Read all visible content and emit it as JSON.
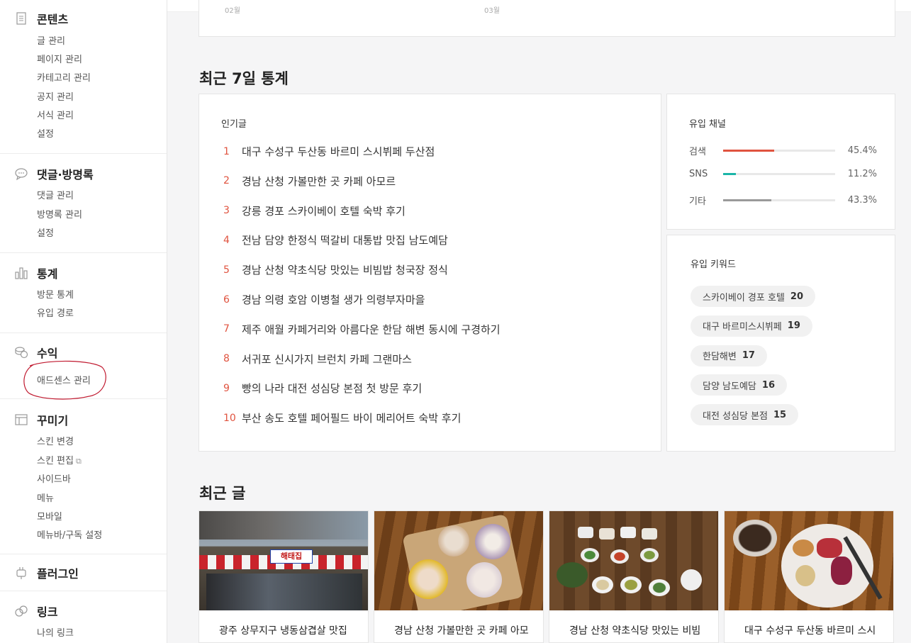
{
  "sidebar": {
    "sections": [
      {
        "icon": "document-icon",
        "title": "콘텐츠",
        "items": [
          "글 관리",
          "페이지 관리",
          "카테고리 관리",
          "공지 관리",
          "서식 관리",
          "설정"
        ]
      },
      {
        "icon": "speech-bubble-icon",
        "title": "댓글·방명록",
        "items": [
          "댓글 관리",
          "방명록 관리",
          "설정"
        ]
      },
      {
        "icon": "bar-chart-icon",
        "title": "통계",
        "items": [
          "방문 통계",
          "유입 경로"
        ]
      },
      {
        "icon": "coins-icon",
        "title": "수익",
        "items": [
          "애드센스 관리"
        ]
      },
      {
        "icon": "layout-icon",
        "title": "꾸미기",
        "items": [
          "스킨 변경",
          "스킨 편집",
          "사이드바",
          "메뉴",
          "모바일",
          "메뉴바/구독 설정"
        ]
      },
      {
        "icon": "plug-icon",
        "title": "플러그인",
        "items": []
      },
      {
        "icon": "link-icon",
        "title": "링크",
        "items": [
          "나의 링크"
        ]
      }
    ]
  },
  "top_card": {
    "left_tiny": "02월",
    "right_tiny": "03월"
  },
  "stats": {
    "heading": "최근 7일 통계",
    "popular": {
      "label": "인기글",
      "posts": [
        {
          "rank": "1",
          "title": "대구 수성구 두산동 바르미 스시뷔페 두산점"
        },
        {
          "rank": "2",
          "title": "경남 산청 가볼만한 곳 카페 아모르"
        },
        {
          "rank": "3",
          "title": "강릉 경포 스카이베이 호텔 숙박 후기"
        },
        {
          "rank": "4",
          "title": "전남 담양 한정식 떡갈비 대통밥 맛집 남도예담"
        },
        {
          "rank": "5",
          "title": "경남 산청 약초식당 맛있는 비빔밥 청국장 정식"
        },
        {
          "rank": "6",
          "title": "경남 의령 호암 이병철 생가 의령부자마을"
        },
        {
          "rank": "7",
          "title": "제주 애월 카페거리와 아름다운 한담 해변 동시에 구경하기"
        },
        {
          "rank": "8",
          "title": "서귀포 신시가지 브런치 카페 그랜마스"
        },
        {
          "rank": "9",
          "title": "빵의 나라 대전 성심당 본점 첫 방문 후기"
        },
        {
          "rank": "10",
          "title": "부산 송도 호텔 페어필드 바이 메리어트 숙박 후기"
        }
      ]
    },
    "channels": {
      "label": "유입 채널",
      "items": [
        {
          "name": "검색",
          "pct": "45.4%",
          "fraction": 0.454,
          "color": "#e0533f"
        },
        {
          "name": "SNS",
          "pct": "11.2%",
          "fraction": 0.112,
          "color": "#1bb5a8"
        },
        {
          "name": "기타",
          "pct": "43.3%",
          "fraction": 0.433,
          "color": "#9a9a9a"
        }
      ]
    },
    "keywords": {
      "label": "유입 키워드",
      "items": [
        {
          "text": "스카이베이 경포 호텔",
          "count": "20"
        },
        {
          "text": "대구 바르미스시뷔페",
          "count": "19"
        },
        {
          "text": "한담해변",
          "count": "17"
        },
        {
          "text": "담양 남도예담",
          "count": "16"
        },
        {
          "text": "대전 성심당 본점",
          "count": "15"
        }
      ]
    }
  },
  "recent": {
    "heading": "최근 글",
    "posts": [
      {
        "title": "광주 상무지구 냉동삼겹살 맛집 해태집 본점",
        "sign": "해태집"
      },
      {
        "title": "경남 산청 가볼만한 곳 카페 아모르"
      },
      {
        "title": "경남 산청 약초식당 맛있는 비빔밥 청국장 정식"
      },
      {
        "title": "대구 수성구 두산동 바르미 스시뷔페 두산점"
      }
    ]
  }
}
